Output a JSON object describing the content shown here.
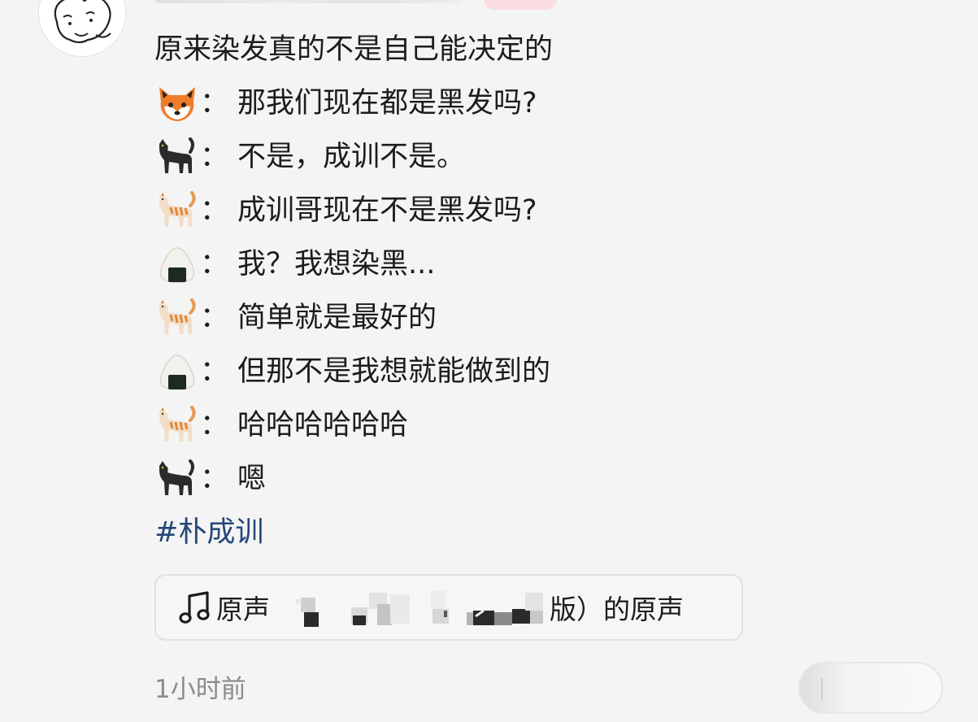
{
  "post": {
    "lines": [
      {
        "speaker": "",
        "text": "原来染发真的不是自己能决定的"
      },
      {
        "speaker": "fox-emoji",
        "sep": "：",
        "text": "那我们现在都是黑发吗?"
      },
      {
        "speaker": "black-cat-emoji",
        "sep": "：",
        "text": "不是，成训不是。"
      },
      {
        "speaker": "orange-cat-emoji",
        "sep": "：",
        "text": "成训哥现在不是黑发吗?"
      },
      {
        "speaker": "rice-ball-emoji",
        "sep": "：",
        "text": "我？我想染黑..."
      },
      {
        "speaker": "orange-cat-emoji",
        "sep": "：",
        "text": "简单就是最好的"
      },
      {
        "speaker": "rice-ball-emoji",
        "sep": "：",
        "text": "但那不是我想就能做到的"
      },
      {
        "speaker": "orange-cat-emoji",
        "sep": "：",
        "text": "哈哈哈哈哈哈"
      },
      {
        "speaker": "black-cat-emoji",
        "sep": "：",
        "text": "嗯"
      }
    ],
    "hashtag": "#朴成训"
  },
  "sound": {
    "icon": "music-note-icon",
    "label": "原声",
    "tail": "版）的原声"
  },
  "meta": {
    "timestamp": "1小时前"
  },
  "colors": {
    "hashtag": "#24477a",
    "text": "#1c1c1c",
    "muted": "#8b8b8b",
    "background": "#f4f4f4"
  }
}
